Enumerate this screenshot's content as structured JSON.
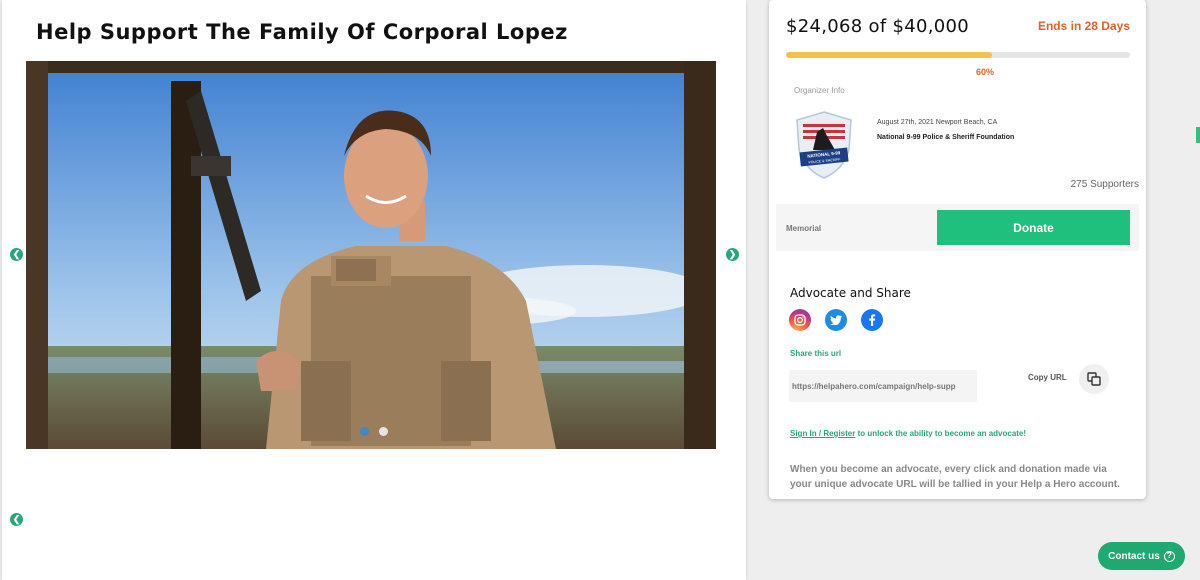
{
  "page": {
    "title": "Help Support The Family Of Corporal Lopez"
  },
  "carousel": {
    "slides_count": 2,
    "active_slide": 1
  },
  "campaign": {
    "raised_text": "$24,068 of $40,000",
    "ends_text": "Ends in 28 Days",
    "progress_percent": 60,
    "progress_label": "60%",
    "supporters_text": "275 Supporters"
  },
  "organizer": {
    "label": "Organizer Info",
    "date_location": "August 27th, 2021 Newport Beach, CA",
    "name": "National 9-99 Police & Sheriff Foundation",
    "badge_top": "NATIONAL 9-99",
    "badge_bottom": "POLICE & SHERIFF"
  },
  "donate": {
    "memorial_label": "Memorial",
    "button_label": "Donate"
  },
  "advocate": {
    "title": "Advocate and Share",
    "share_url_label": "Share this url",
    "url_value": "https://helpahero.com/campaign/help-supp",
    "copy_url_label": "Copy URL",
    "signin_link": "Sign In / Register",
    "signin_rest": " to unlock the ability to become an advocate!",
    "explanation": "When you become an advocate, every click and donation made via your unique advocate URL will be tallied in your Help a Hero account."
  },
  "contact": {
    "label": "Contact us"
  },
  "colors": {
    "accent_green": "#1fc07e",
    "orange": "#e4622a",
    "progress_yellow": "#f2c14e"
  }
}
